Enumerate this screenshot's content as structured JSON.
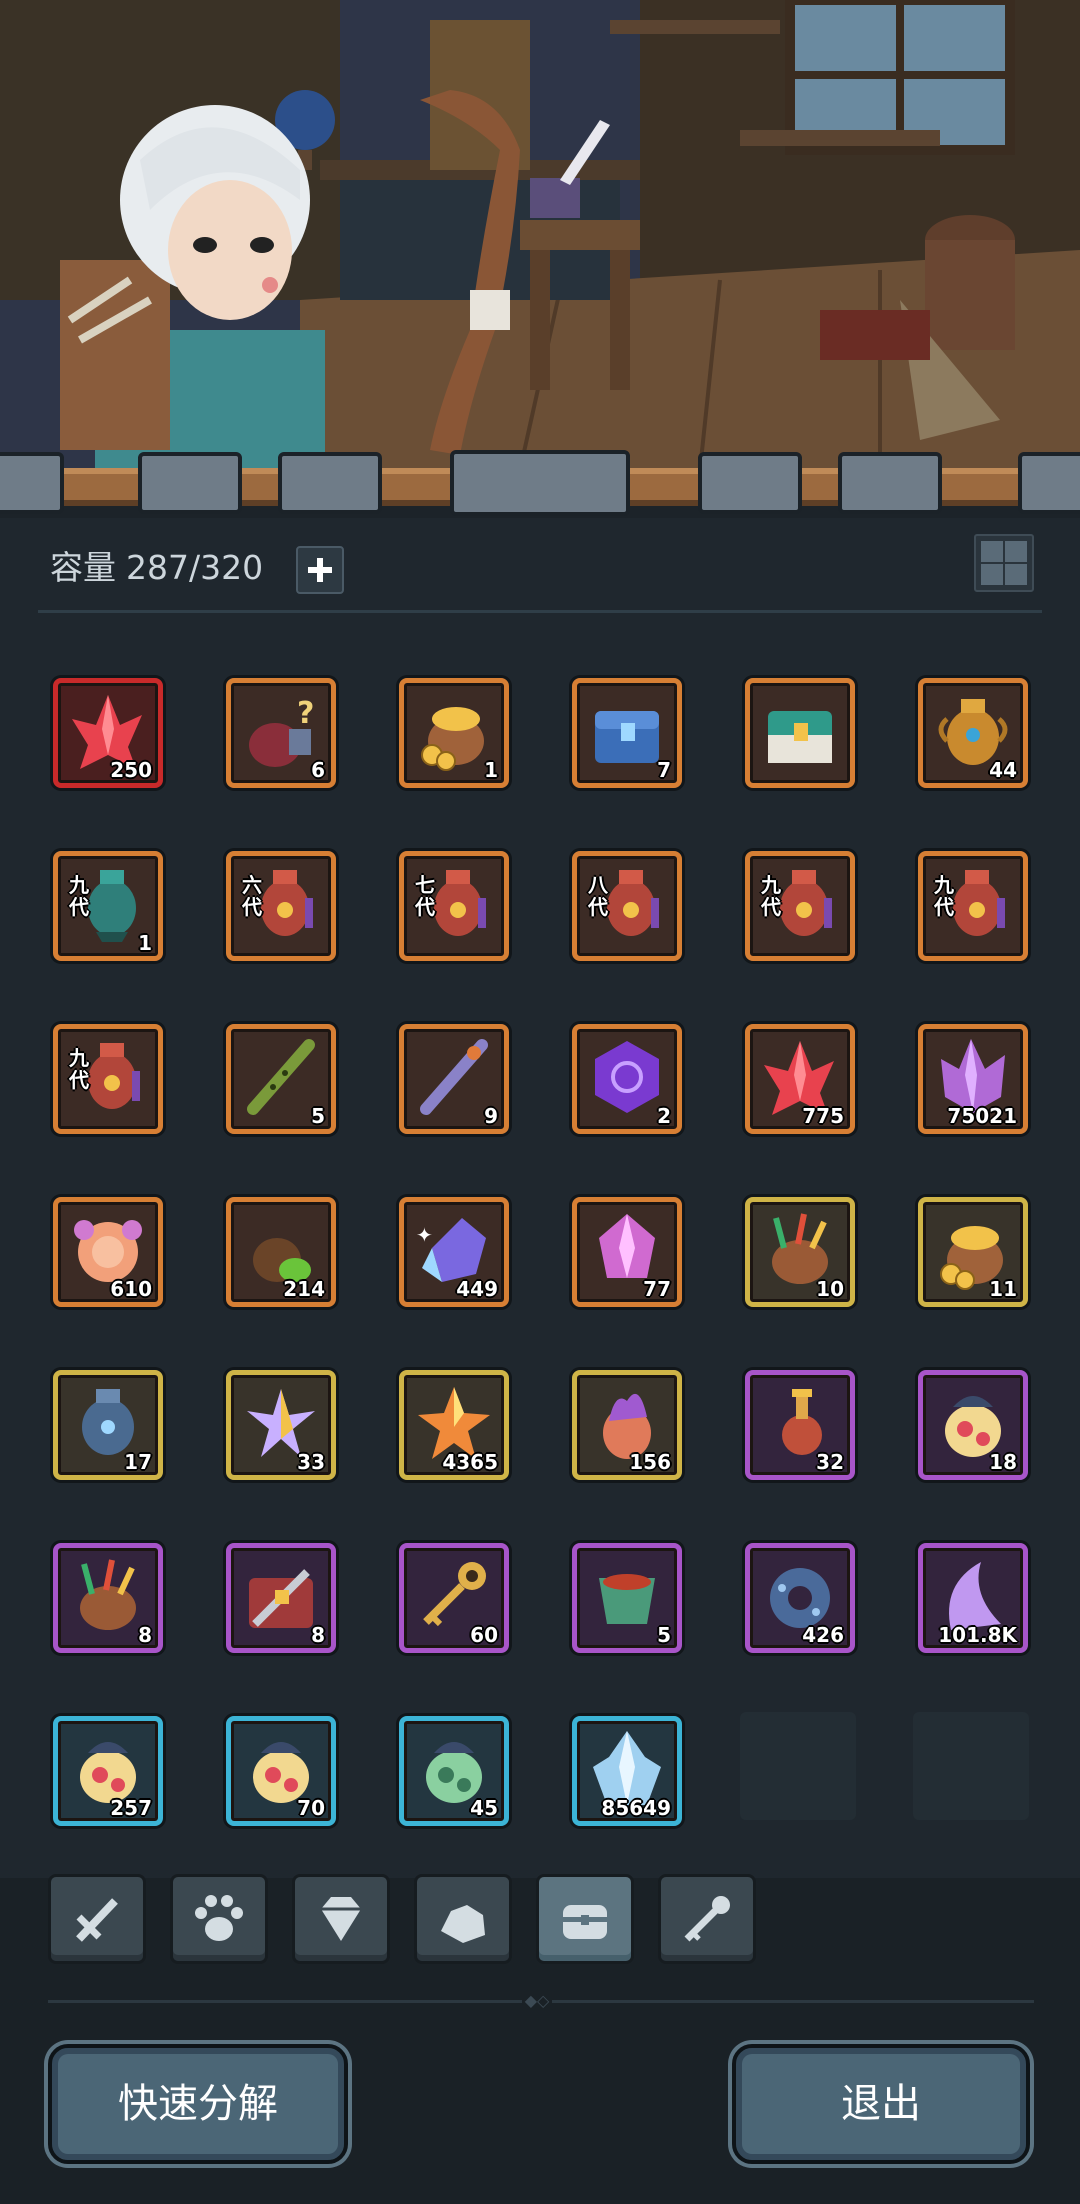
{
  "inventory": {
    "capacity_label": "容量",
    "capacity_value": "287/320"
  },
  "items": [
    {
      "icon": "red-crystal-icon",
      "rarity": "red",
      "qty": "250"
    },
    {
      "icon": "mystery-bag-icon",
      "rarity": "orange",
      "qty": "6"
    },
    {
      "icon": "gold-pouch-icon",
      "rarity": "orange",
      "qty": "1"
    },
    {
      "icon": "blue-chest-icon",
      "rarity": "orange",
      "qty": "7"
    },
    {
      "icon": "teal-chest-icon",
      "rarity": "orange",
      "qty": ""
    },
    {
      "icon": "golden-urn-icon",
      "rarity": "orange",
      "qty": "44"
    },
    {
      "icon": "teal-urn-icon",
      "rarity": "orange",
      "qty": "1",
      "gen": "九代"
    },
    {
      "icon": "red-urn-icon",
      "rarity": "orange",
      "qty": "",
      "gen": "六代"
    },
    {
      "icon": "red-urn-icon",
      "rarity": "orange",
      "qty": "",
      "gen": "七代"
    },
    {
      "icon": "red-urn-icon",
      "rarity": "orange",
      "qty": "",
      "gen": "八代"
    },
    {
      "icon": "red-urn-icon",
      "rarity": "orange",
      "qty": "",
      "gen": "九代"
    },
    {
      "icon": "red-urn-icon",
      "rarity": "orange",
      "qty": "",
      "gen": "九代"
    },
    {
      "icon": "red-urn-icon",
      "rarity": "orange",
      "qty": "",
      "gen": "九代"
    },
    {
      "icon": "green-flute-icon",
      "rarity": "orange",
      "qty": "5"
    },
    {
      "icon": "purple-flute-icon",
      "rarity": "orange",
      "qty": "9"
    },
    {
      "icon": "purple-hex-coin-icon",
      "rarity": "orange",
      "qty": "2"
    },
    {
      "icon": "red-crystal-icon",
      "rarity": "orange",
      "qty": "775"
    },
    {
      "icon": "purple-crystal-icon",
      "rarity": "orange",
      "qty": "75021"
    },
    {
      "icon": "pink-orb-icon",
      "rarity": "orange",
      "qty": "610"
    },
    {
      "icon": "green-sack-icon",
      "rarity": "orange",
      "qty": "214"
    },
    {
      "icon": "blue-gem-icon",
      "rarity": "orange",
      "qty": "449"
    },
    {
      "icon": "pink-gem-icon",
      "rarity": "orange",
      "qty": "77"
    },
    {
      "icon": "feather-pouch-icon",
      "rarity": "yellow",
      "qty": "10"
    },
    {
      "icon": "gold-pouch-icon",
      "rarity": "yellow",
      "qty": "11"
    },
    {
      "icon": "blue-urn-icon",
      "rarity": "yellow",
      "qty": "17"
    },
    {
      "icon": "star-shard-icon",
      "rarity": "yellow",
      "qty": "33"
    },
    {
      "icon": "orange-star-icon",
      "rarity": "yellow",
      "qty": "4365"
    },
    {
      "icon": "flame-egg-icon",
      "rarity": "yellow",
      "qty": "156"
    },
    {
      "icon": "potion-icon",
      "rarity": "purple",
      "qty": "32"
    },
    {
      "icon": "egg-sack-icon",
      "rarity": "purple",
      "qty": "18"
    },
    {
      "icon": "feather-pouch-icon",
      "rarity": "purple",
      "qty": "8"
    },
    {
      "icon": "weapon-chest-icon",
      "rarity": "purple",
      "qty": "8"
    },
    {
      "icon": "golden-key-icon",
      "rarity": "purple",
      "qty": "60"
    },
    {
      "icon": "green-pot-icon",
      "rarity": "purple",
      "qty": "5"
    },
    {
      "icon": "blue-ring-stone-icon",
      "rarity": "purple",
      "qty": "426"
    },
    {
      "icon": "purple-horn-icon",
      "rarity": "purple",
      "qty": "101.8K"
    },
    {
      "icon": "egg-sack-icon",
      "rarity": "blue",
      "qty": "257"
    },
    {
      "icon": "egg-sack-icon",
      "rarity": "blue",
      "qty": "70"
    },
    {
      "icon": "green-egg-sack-icon",
      "rarity": "blue",
      "qty": "45"
    },
    {
      "icon": "ice-crystal-icon",
      "rarity": "blue",
      "qty": "85649"
    }
  ],
  "tabs": [
    {
      "icon": "sword-tab-icon",
      "active": false
    },
    {
      "icon": "paw-tab-icon",
      "active": false
    },
    {
      "icon": "diamond-tab-icon",
      "active": false
    },
    {
      "icon": "stone-tab-icon",
      "active": false
    },
    {
      "icon": "chest-tab-icon",
      "active": true
    },
    {
      "icon": "key-tab-icon",
      "active": false
    }
  ],
  "buttons": {
    "quick_decompose": "快速分解",
    "exit": "退出"
  }
}
